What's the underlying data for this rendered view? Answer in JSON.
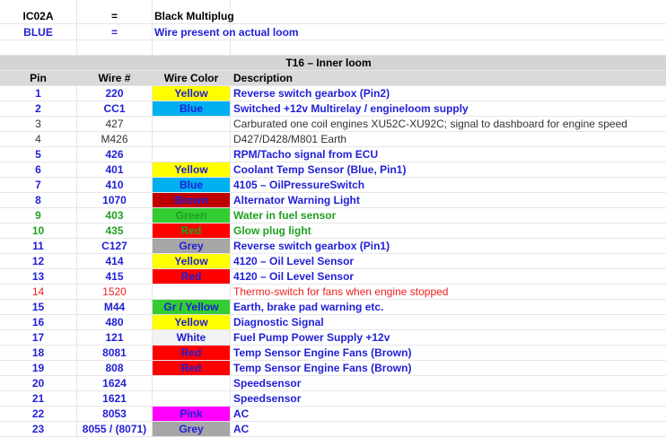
{
  "legend": [
    {
      "code": "IC02A",
      "eq": "=",
      "text": "Black Multiplug",
      "style": "black"
    },
    {
      "code": "BLUE",
      "eq": "=",
      "text": "Wire present on actual loom",
      "style": "blue"
    }
  ],
  "table": {
    "title": "T16 – Inner loom",
    "headers": {
      "pin": "Pin",
      "wire": "Wire #",
      "color": "Wire Color",
      "desc": "Description"
    },
    "rows": [
      {
        "pin": "1",
        "wire": "220",
        "color": "Yellow",
        "bg": "#ffff00",
        "fg": "#1f1fd6",
        "desc": "Reverse switch gearbox (Pin2)",
        "style": "blue"
      },
      {
        "pin": "2",
        "wire": "CC1",
        "color": "Blue",
        "bg": "#00b0f0",
        "fg": "#1f1fd6",
        "desc": "Switched +12v Multirelay / engineloom supply",
        "style": "blue"
      },
      {
        "pin": "3",
        "wire": "427",
        "color": "",
        "bg": "",
        "fg": "",
        "desc": "Carburated one coil engines XU52C-XU92C; signal to dashboard for engine speed",
        "style": "black"
      },
      {
        "pin": "4",
        "wire": "M426",
        "color": "",
        "bg": "",
        "fg": "",
        "desc": "D427/D428/M801 Earth",
        "style": "black"
      },
      {
        "pin": "5",
        "wire": "426",
        "color": "",
        "bg": "",
        "fg": "",
        "desc": "RPM/Tacho signal from ECU",
        "style": "blue"
      },
      {
        "pin": "6",
        "wire": "401",
        "color": "Yellow",
        "bg": "#ffff00",
        "fg": "#1f1fd6",
        "desc": "Coolant Temp Sensor (Blue, Pin1)",
        "style": "blue"
      },
      {
        "pin": "7",
        "wire": "410",
        "color": "Blue",
        "bg": "#00b0f0",
        "fg": "#1f1fd6",
        "desc": "4105 – OilPressureSwitch",
        "style": "blue"
      },
      {
        "pin": "8",
        "wire": "1070",
        "color": "Brown",
        "bg": "#c00000",
        "fg": "#1f1fd6",
        "desc": "Alternator Warning Light",
        "style": "blue"
      },
      {
        "pin": "9",
        "wire": "403",
        "color": "Green",
        "bg": "#33cc33",
        "fg": "#1fa01f",
        "desc": "Water in fuel sensor",
        "style": "green"
      },
      {
        "pin": "10",
        "wire": "435",
        "color": "Red",
        "bg": "#ff0000",
        "fg": "#1fa01f",
        "desc": "Glow plug light",
        "style": "green"
      },
      {
        "pin": "11",
        "wire": "C127",
        "color": "Grey",
        "bg": "#a6a6a6",
        "fg": "#1f1fd6",
        "desc": "Reverse switch gearbox (Pin1)",
        "style": "blue"
      },
      {
        "pin": "12",
        "wire": "414",
        "color": "Yellow",
        "bg": "#ffff00",
        "fg": "#1f1fd6",
        "desc": "4120 – Oil Level Sensor",
        "style": "blue"
      },
      {
        "pin": "13",
        "wire": "415",
        "color": "Red",
        "bg": "#ff0000",
        "fg": "#1f1fd6",
        "desc": "4120 – Oil Level Sensor",
        "style": "blue"
      },
      {
        "pin": "14",
        "wire": "1520",
        "color": "",
        "bg": "",
        "fg": "",
        "desc": "Thermo-switch for fans when engine stopped",
        "style": "red"
      },
      {
        "pin": "15",
        "wire": "M44",
        "color": "Gr / Yellow",
        "bg": "#33cc33",
        "fg": "#1f1fd6",
        "desc": "Earth, brake pad warning etc.",
        "style": "blue"
      },
      {
        "pin": "16",
        "wire": "480",
        "color": "Yellow",
        "bg": "#ffff00",
        "fg": "#1f1fd6",
        "desc": "Diagnostic Signal",
        "style": "blue"
      },
      {
        "pin": "17",
        "wire": "121",
        "color": "White",
        "bg": "#f2f2f2",
        "fg": "#1f1fd6",
        "desc": "Fuel Pump Power Supply +12v",
        "style": "blue"
      },
      {
        "pin": "18",
        "wire": "8081",
        "color": "Red",
        "bg": "#ff0000",
        "fg": "#1f1fd6",
        "desc": "Temp Sensor Engine Fans (Brown)",
        "style": "blue"
      },
      {
        "pin": "19",
        "wire": "808",
        "color": "Red",
        "bg": "#ff0000",
        "fg": "#1f1fd6",
        "desc": "Temp Sensor Engine Fans (Brown)",
        "style": "blue"
      },
      {
        "pin": "20",
        "wire": "1624",
        "color": "",
        "bg": "",
        "fg": "",
        "desc": "Speedsensor",
        "style": "blue"
      },
      {
        "pin": "21",
        "wire": "1621",
        "color": "",
        "bg": "",
        "fg": "",
        "desc": "Speedsensor",
        "style": "blue"
      },
      {
        "pin": "22",
        "wire": "8053",
        "color": "Pink",
        "bg": "#ff00ff",
        "fg": "#1f1fd6",
        "desc": "AC",
        "style": "blue"
      },
      {
        "pin": "23",
        "wire": "8055 / (8071)",
        "color": "Grey",
        "bg": "#a6a6a6",
        "fg": "#1f1fd6",
        "desc": "AC",
        "style": "blue"
      }
    ]
  }
}
